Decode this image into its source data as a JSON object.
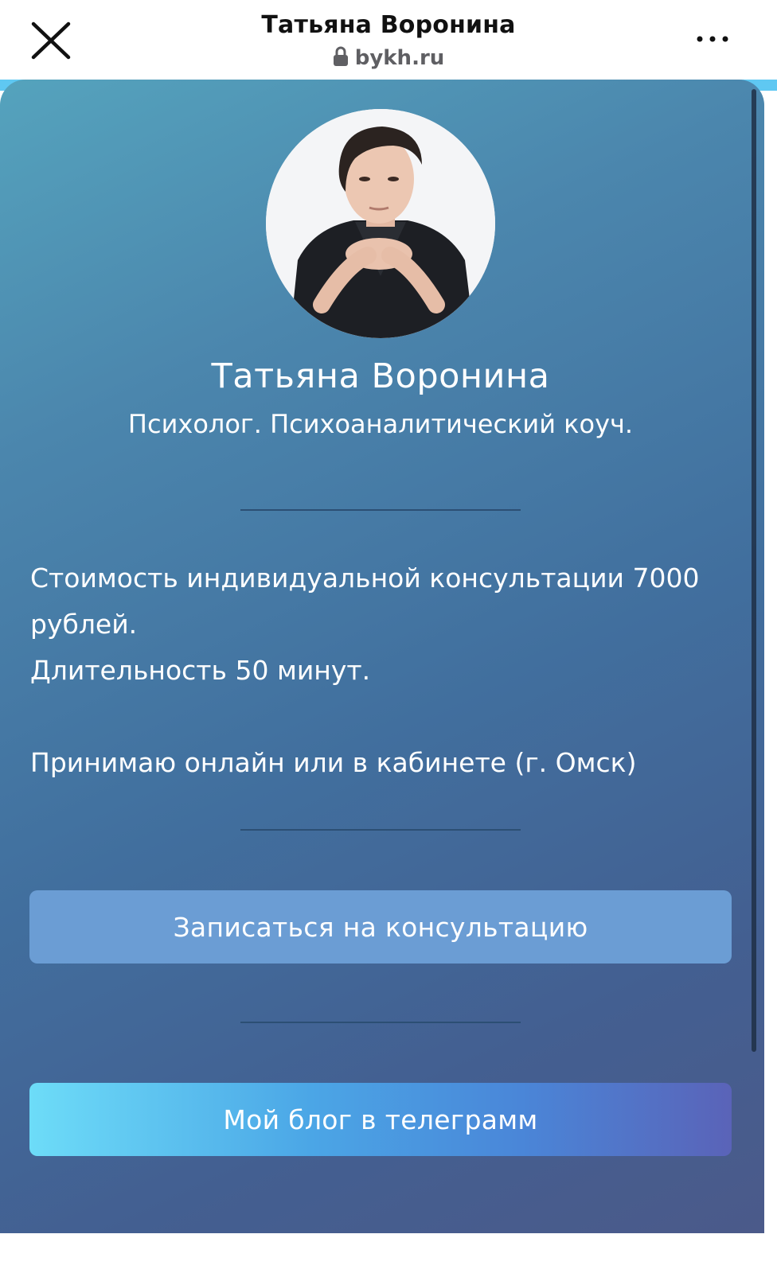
{
  "browser": {
    "title": "Татьяна Воронина",
    "url": "bykh.ru",
    "close_icon": "close-icon",
    "lock_icon": "lock-icon",
    "more_icon": "more-icon"
  },
  "profile": {
    "name": "Татьяна Воронина",
    "subtitle": "Психолог. Психоаналитический коуч."
  },
  "info": {
    "price_line": "Стоимость индивидуальной консультации 7000 рублей.",
    "duration_line": "Длительность 50 минут.",
    "location_line": "Принимаю онлайн или в кабинете (г. Омск)"
  },
  "buttons": {
    "consult_label": "Записаться на консультацию",
    "telegram_label": "Мой блог в телеграмм"
  },
  "colors": {
    "gradient_top": "#55a3bd",
    "gradient_bottom": "#4b5a8a",
    "consult_button": "#6b9dd4",
    "telegram_button_start": "#6ddcf8",
    "telegram_button_end": "#5a63b8"
  }
}
